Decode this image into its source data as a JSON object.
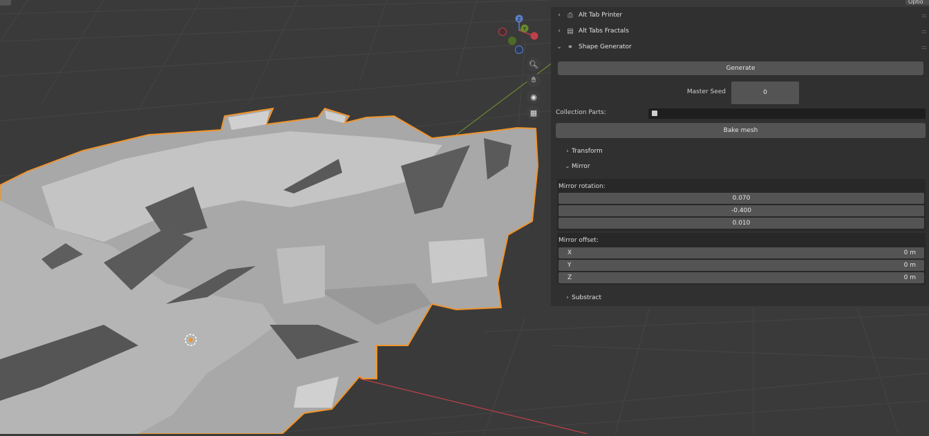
{
  "viewport": {
    "gizmo": {
      "z": "Z",
      "y": "Y"
    },
    "nav_buttons": [
      "zoom-icon",
      "hand-icon",
      "camera-icon",
      "grid-icon"
    ],
    "top_right_button": "Optio",
    "colors": {
      "outline": "#f0932b",
      "x_axis": "#c0404a",
      "y_axis": "#6a8a2e",
      "background": "#3a3a3a"
    }
  },
  "sidebar": {
    "panels": [
      {
        "label": "Alt Tab Printer",
        "icon": "printer-icon",
        "expanded": false
      },
      {
        "label": "Alt Tabs Fractals",
        "icon": "fractal-icon",
        "expanded": false
      },
      {
        "label": "Shape Generator",
        "icon": "shape-icon",
        "expanded": true
      }
    ],
    "generate_label": "Generate",
    "master_seed": {
      "label": "Master Seed",
      "value": "0"
    },
    "collection_parts": {
      "label": "Collection Parts:",
      "value": ""
    },
    "bake_label": "Bake mesh",
    "transform_label": "Transform",
    "mirror_label": "Mirror",
    "mirror_rotation": {
      "label": "Mirror rotation:",
      "values": [
        "0.070",
        "-0.400",
        "0.010"
      ]
    },
    "mirror_offset": {
      "label": "Mirror offset:",
      "rows": [
        {
          "axis": "X",
          "value": "0 m"
        },
        {
          "axis": "Y",
          "value": "0 m"
        },
        {
          "axis": "Z",
          "value": "0 m"
        }
      ]
    },
    "substract_label": "Substract"
  }
}
